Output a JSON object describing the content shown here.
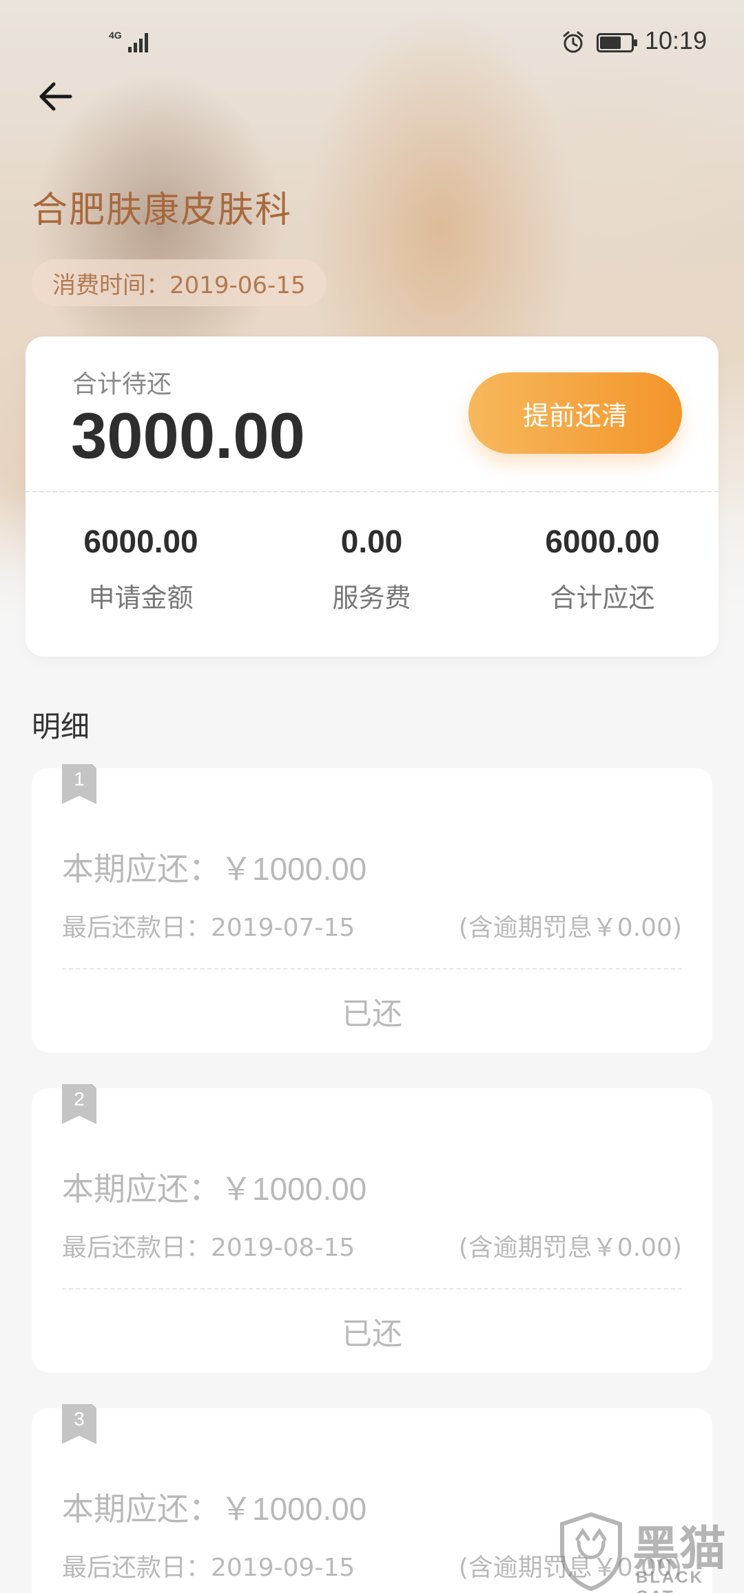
{
  "status_bar": {
    "network": "4G",
    "time": "10:19",
    "icons": [
      "signal-icon",
      "alarm-icon",
      "battery-icon"
    ]
  },
  "header": {
    "back_icon": "back-arrow-icon",
    "merchant": "合肥肤康皮肤科",
    "date_label": "消费时间：2019-06-15"
  },
  "summary": {
    "label": "合计待还",
    "amount": "3000.00",
    "payoff_button": "提前还清",
    "stats": [
      {
        "value": "6000.00",
        "caption": "申请金额"
      },
      {
        "value": "0.00",
        "caption": "服务费"
      },
      {
        "value": "6000.00",
        "caption": "合计应还"
      }
    ]
  },
  "details": {
    "title": "明细",
    "installments": [
      {
        "index": "1",
        "due_label": "本期应还：",
        "due_amount": "￥1000.00",
        "deadline": "最后还款日：2019-07-15",
        "penalty": "(含逾期罚息￥0.00)",
        "state": "已还"
      },
      {
        "index": "2",
        "due_label": "本期应还：",
        "due_amount": "￥1000.00",
        "deadline": "最后还款日：2019-08-15",
        "penalty": "(含逾期罚息￥0.00)",
        "state": "已还"
      },
      {
        "index": "3",
        "due_label": "本期应还：",
        "due_amount": "￥1000.00",
        "deadline": "最后还款日：2019-09-15",
        "penalty": "(含逾期罚息￥0.00)",
        "state": ""
      }
    ]
  },
  "watermark": {
    "cn": "黑猫",
    "en": "BLACK CAT"
  },
  "colors": {
    "accent_start": "#f6b85c",
    "accent_end": "#f3952a",
    "merchant_text": "#a8693d",
    "muted_text": "#b9b9b9"
  }
}
